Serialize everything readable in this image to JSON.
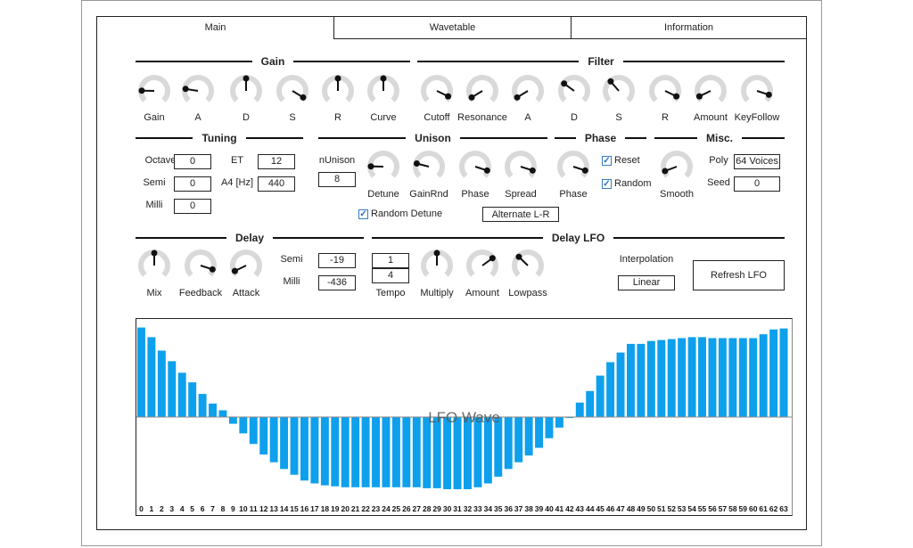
{
  "tabs": [
    {
      "label": "Main",
      "selected": true
    },
    {
      "label": "Wavetable"
    },
    {
      "label": "Information"
    }
  ],
  "sections": {
    "gain": "Gain",
    "filter": "Filter",
    "tuning": "Tuning",
    "unison": "Unison",
    "phase": "Phase",
    "misc": "Misc.",
    "delay": "Delay",
    "delay_lfo": "Delay LFO"
  },
  "gain_knobs": [
    {
      "label": "Gain",
      "value": 0.17
    },
    {
      "label": "A",
      "value": 0.2
    },
    {
      "label": "D",
      "value": 0.5
    },
    {
      "label": "S",
      "value": 0.95
    },
    {
      "label": "R",
      "value": 0.5
    },
    {
      "label": "Curve",
      "value": 0.5
    }
  ],
  "filter_knobs": [
    {
      "label": "Cutoff",
      "value": 0.93
    },
    {
      "label": "Resonance",
      "value": 0.05
    },
    {
      "label": "A",
      "value": 0.05
    },
    {
      "label": "D",
      "value": 0.3
    },
    {
      "label": "S",
      "value": 0.35
    },
    {
      "label": "R",
      "value": 0.93
    },
    {
      "label": "Amount",
      "value": 0.07
    },
    {
      "label": "KeyFollow",
      "value": 0.9
    }
  ],
  "tuning": {
    "octave_label": "Octave",
    "octave": "0",
    "semi_label": "Semi",
    "semi": "0",
    "milli_label": "Milli",
    "milli": "0",
    "et_label": "ET",
    "et": "12",
    "a4_label": "A4 [Hz]",
    "a4": "440"
  },
  "unison": {
    "n_label": "nUnison",
    "n": "8",
    "knobs": [
      {
        "label": "Detune",
        "value": 0.17
      },
      {
        "label": "GainRnd",
        "value": 0.22
      },
      {
        "label": "Phase",
        "value": 0.9
      },
      {
        "label": "Spread",
        "value": 0.9
      }
    ],
    "random_detune_label": "Random Detune",
    "random_detune": true,
    "mode": "Alternate L-R"
  },
  "phase": {
    "knob": {
      "label": "Phase",
      "value": 0.9
    },
    "reset_label": "Reset",
    "reset": true,
    "random_label": "Random",
    "random": true
  },
  "misc": {
    "smooth": {
      "label": "Smooth",
      "value": 0.09
    },
    "poly_label": "Poly",
    "poly": "64 Voices",
    "seed_label": "Seed",
    "seed": "0"
  },
  "delay": {
    "knobs": [
      {
        "label": "Mix",
        "value": 0.5
      },
      {
        "label": "Feedback",
        "value": 0.9
      },
      {
        "label": "Attack",
        "value": 0.07
      }
    ],
    "semi_label": "Semi",
    "semi": "-19",
    "milli_label": "Milli",
    "milli": "-436"
  },
  "delay_lfo": {
    "tempo_num": "1",
    "tempo_den": "4",
    "tempo_label": "Tempo",
    "knobs": [
      {
        "label": "Multiply",
        "value": 0.5
      },
      {
        "label": "Amount",
        "value": 0.7
      },
      {
        "label": "Lowpass",
        "value": 0.33
      }
    ],
    "interp_label": "Interpolation",
    "interp": "Linear",
    "refresh_label": "Refresh LFO"
  },
  "colors": {
    "bar": "#0ea0ec",
    "knob_track": "#d9d9d9",
    "pointer": "#111111"
  },
  "chart_data": {
    "type": "bar",
    "title": "LFO Wave",
    "ylim": [
      -1,
      1
    ],
    "categories": [
      0,
      1,
      2,
      3,
      4,
      5,
      6,
      7,
      8,
      9,
      10,
      11,
      12,
      13,
      14,
      15,
      16,
      17,
      18,
      19,
      20,
      21,
      22,
      23,
      24,
      25,
      26,
      27,
      28,
      29,
      30,
      31,
      32,
      33,
      34,
      35,
      36,
      37,
      38,
      39,
      40,
      41,
      42,
      43,
      44,
      45,
      46,
      47,
      48,
      49,
      50,
      51,
      52,
      53,
      54,
      55,
      56,
      57,
      58,
      59,
      60,
      61,
      62,
      63
    ],
    "values": [
      0.93,
      0.83,
      0.69,
      0.58,
      0.46,
      0.36,
      0.24,
      0.14,
      0.07,
      -0.07,
      -0.17,
      -0.28,
      -0.39,
      -0.47,
      -0.54,
      -0.6,
      -0.66,
      -0.69,
      -0.71,
      -0.72,
      -0.73,
      -0.73,
      -0.73,
      -0.73,
      -0.73,
      -0.73,
      -0.73,
      -0.73,
      -0.74,
      -0.74,
      -0.75,
      -0.75,
      -0.75,
      -0.73,
      -0.69,
      -0.62,
      -0.54,
      -0.47,
      -0.4,
      -0.32,
      -0.22,
      -0.11,
      -0.01,
      0.15,
      0.27,
      0.43,
      0.57,
      0.67,
      0.76,
      0.76,
      0.79,
      0.8,
      0.81,
      0.82,
      0.83,
      0.83,
      0.82,
      0.82,
      0.82,
      0.82,
      0.82,
      0.86,
      0.91,
      0.92
    ]
  }
}
